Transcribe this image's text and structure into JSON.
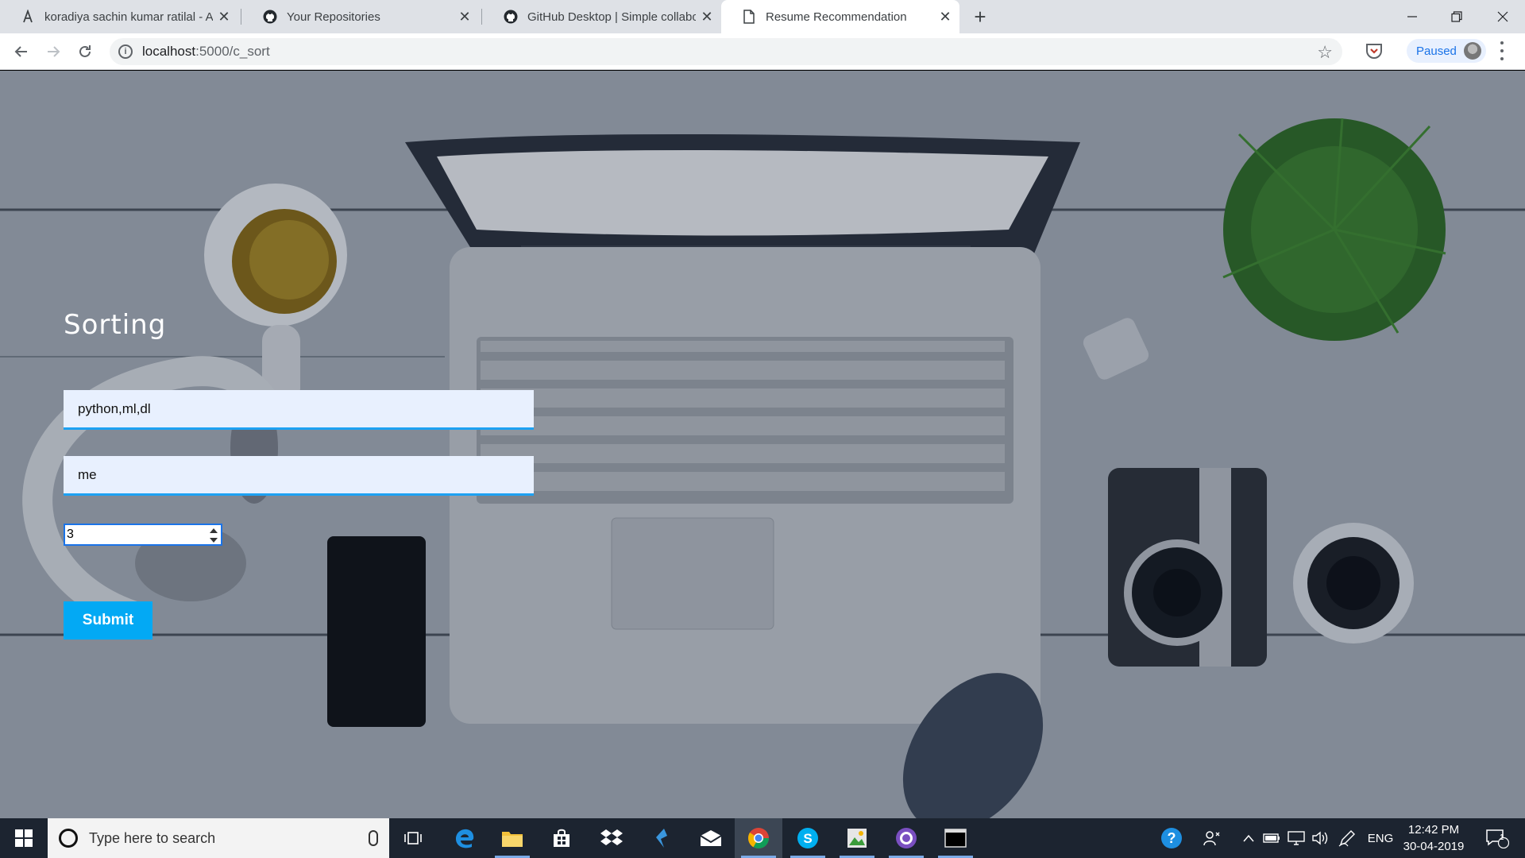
{
  "browser": {
    "tabs": [
      {
        "title": "koradiya sachin kumar ratilal - Ar",
        "icon": "hackerearth-icon"
      },
      {
        "title": "Your Repositories",
        "icon": "github-icon"
      },
      {
        "title": "GitHub Desktop | Simple collabo",
        "icon": "github-icon"
      },
      {
        "title": "Resume Recommendation",
        "icon": "document-icon"
      }
    ],
    "url_host": "localhost",
    "url_path": ":5000/c_sort",
    "profile_status": "Paused"
  },
  "page": {
    "heading": "Sorting",
    "skills_value": "python,ml,dl",
    "second_value": "me",
    "count_value": "3",
    "submit_label": "Submit"
  },
  "taskbar": {
    "search_placeholder": "Type here to search",
    "language": "ENG",
    "time": "12:42 PM",
    "date": "30-04-2019",
    "notification_count": "1"
  },
  "colors": {
    "accent": "#1da1f2",
    "submit_bg": "#03a9f4",
    "field_bg": "#e8f0fe"
  }
}
